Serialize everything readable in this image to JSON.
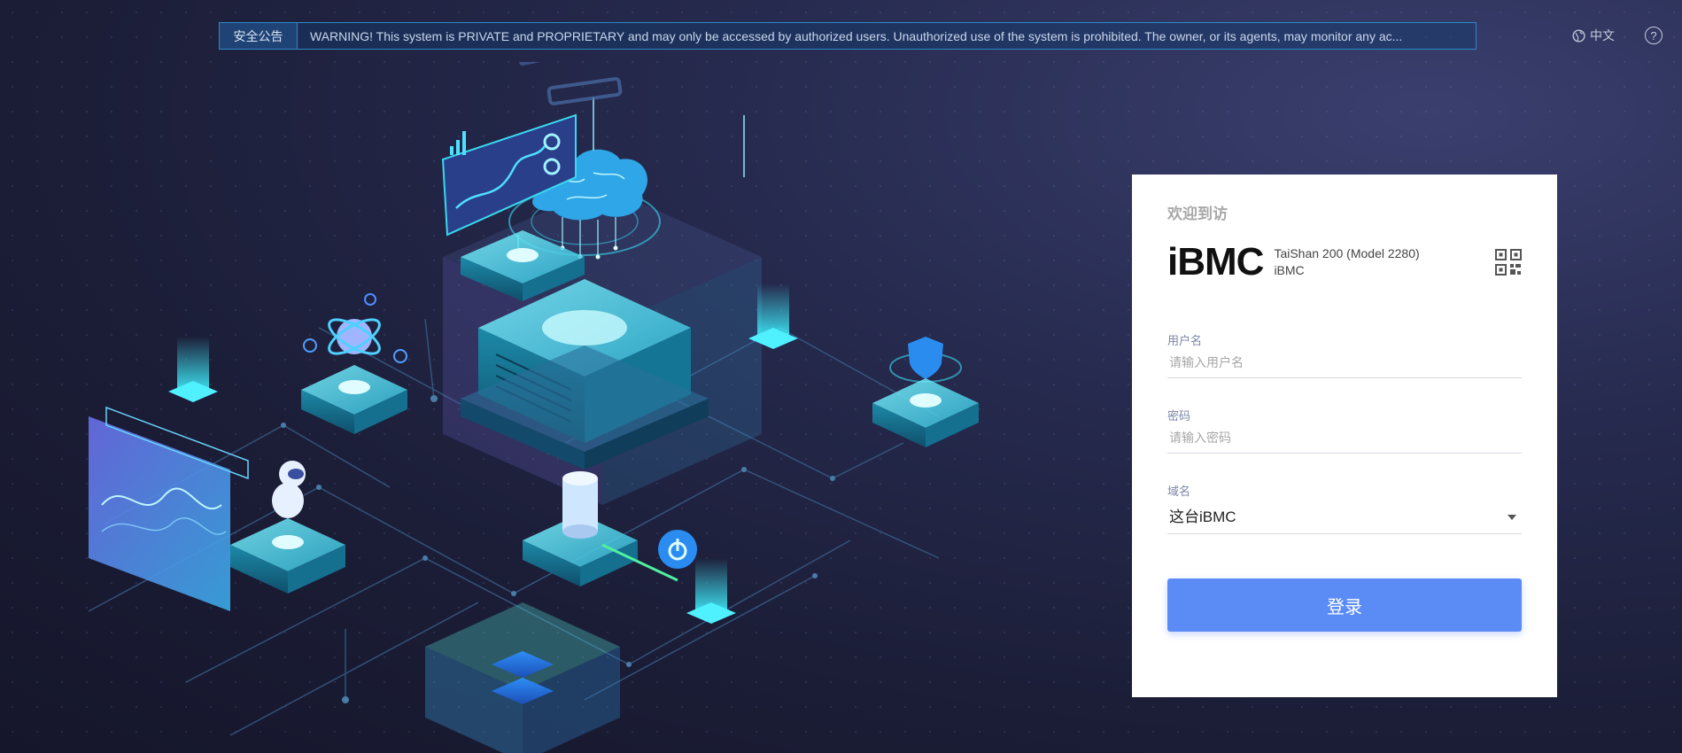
{
  "notice": {
    "tag": "安全公告",
    "text": "WARNING! This system is PRIVATE and PROPRIETARY and may only be accessed by authorized users. Unauthorized use of the system is prohibited. The owner, or its agents, may monitor any ac..."
  },
  "header": {
    "language": "中文",
    "help": "?"
  },
  "login": {
    "welcome": "欢迎到访",
    "logo": "iBMC",
    "model": "TaiShan 200 (Model 2280)",
    "product": "iBMC",
    "username": {
      "label": "用户名",
      "placeholder": "请输入用户名",
      "value": ""
    },
    "password": {
      "label": "密码",
      "placeholder": "请输入密码",
      "value": ""
    },
    "domain": {
      "label": "域名",
      "value": "这台iBMC"
    },
    "submit": "登录"
  },
  "colors": {
    "accent": "#5b8cf6",
    "notice_border": "#2d88c8",
    "glow": "#3ad8f0"
  }
}
